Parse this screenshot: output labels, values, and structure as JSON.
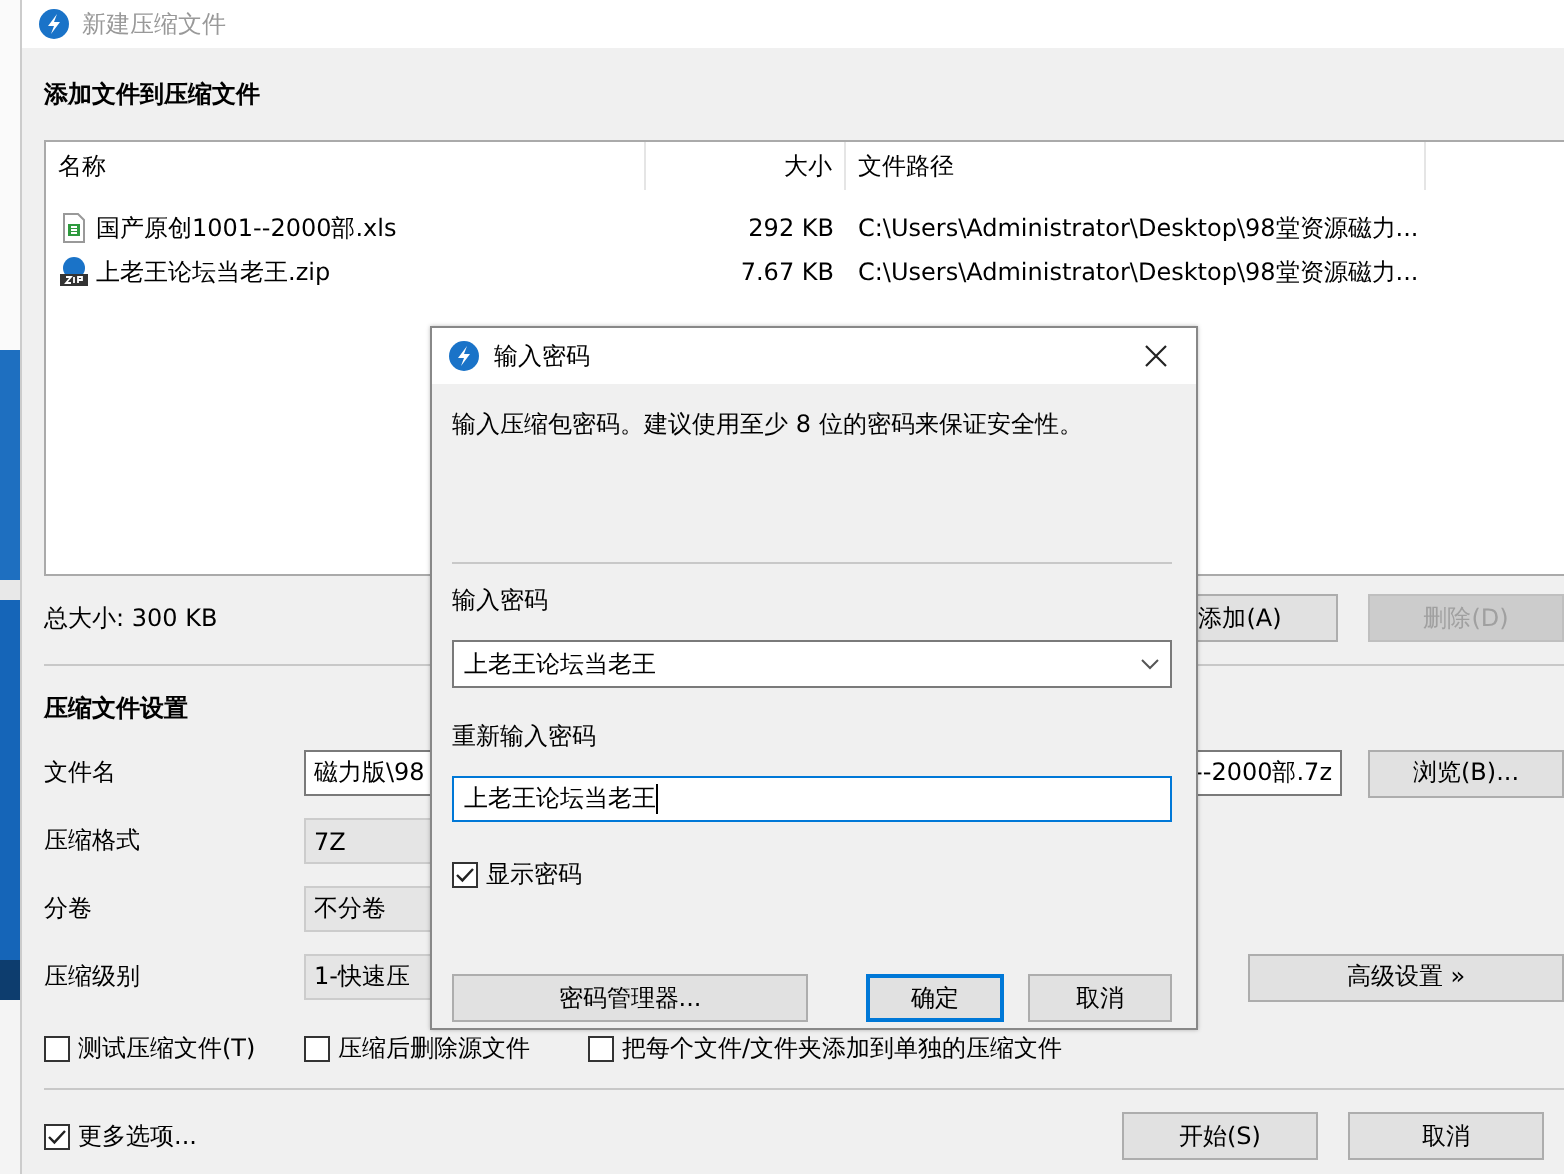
{
  "window": {
    "title": "新建压缩文件",
    "heading": "添加文件到压缩文件"
  },
  "file_list": {
    "columns": [
      "名称",
      "大小",
      "文件路径"
    ],
    "rows": [
      {
        "kind": "sheet",
        "name": "国产原创1001--2000部.xls",
        "size": "292 KB",
        "path": "C:\\Users\\Administrator\\Desktop\\98堂资源磁力..."
      },
      {
        "kind": "zip",
        "name": "上老王论坛当老王.zip",
        "size": "7.67 KB",
        "path": "C:\\Users\\Administrator\\Desktop\\98堂资源磁力..."
      }
    ]
  },
  "total_size": "总大小: 300 KB",
  "list_buttons": [
    {
      "label": "添加(A)",
      "disabled": false
    },
    {
      "label": "删除(D)",
      "disabled": true
    }
  ],
  "settings": {
    "heading": "压缩文件设置",
    "filename": {
      "label": "文件名",
      "value_start": "磁力版\\98",
      "value_end": "--2000部.7z"
    },
    "browse_button": "浏览(B)...",
    "format": {
      "label": "压缩格式",
      "value": "7Z"
    },
    "split": {
      "label": "分卷",
      "value": "不分卷"
    },
    "level": {
      "label": "压缩级别",
      "value": "1-快速压"
    },
    "advanced_button": "高级设置 »",
    "options": [
      {
        "label": "测试压缩文件(T)",
        "checked": false
      },
      {
        "label": "压缩后删除源文件",
        "checked": false
      },
      {
        "label": "把每个文件/文件夹添加到单独的压缩文件",
        "checked": false
      }
    ]
  },
  "more_options": {
    "label": "更多选项...",
    "checked": true
  },
  "footer_buttons": [
    "开始(S)",
    "取消"
  ],
  "dialog": {
    "title": "输入密码",
    "description": "输入压缩包密码。建议使用至少 8 位的密码来保证安全性。",
    "password_label": "输入密码",
    "password_value": "上老王论坛当老王",
    "confirm_label": "重新输入密码",
    "confirm_value": "上老王论坛当老王",
    "show_password": {
      "label": "显示密码",
      "checked": true
    },
    "buttons": [
      {
        "label": "密码管理器...",
        "default": false
      },
      {
        "label": "确定",
        "default": true
      },
      {
        "label": "取消",
        "default": false
      }
    ]
  }
}
